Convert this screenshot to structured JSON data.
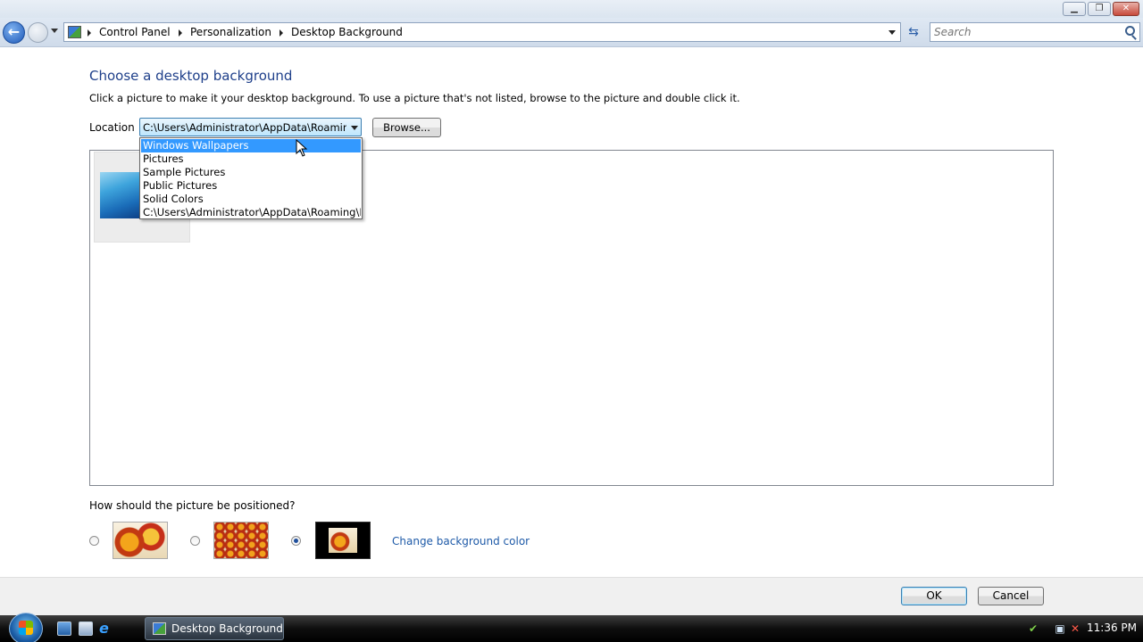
{
  "window": {
    "minimize_symbol": "▁",
    "maximize_symbol": "❐",
    "close_symbol": "✕"
  },
  "nav": {
    "breadcrumbs": [
      "Control Panel",
      "Personalization",
      "Desktop Background"
    ],
    "search_placeholder": "Search",
    "refresh_symbol": "⇆"
  },
  "main": {
    "title": "Choose a desktop background",
    "instructions": "Click a picture to make it your desktop background. To use a picture that's not listed, browse to the picture and double click it.",
    "location_label": "Location",
    "location_value": "C:\\Users\\Administrator\\AppData\\Roaming",
    "browse_label": "Browse...",
    "dropdown_options": [
      "Windows Wallpapers",
      "Pictures",
      "Sample Pictures",
      "Public Pictures",
      "Solid Colors",
      "C:\\Users\\Administrator\\AppData\\Roaming\\Mi"
    ],
    "dropdown_highlighted": "Windows Wallpapers",
    "position_question": "How should the picture be positioned?",
    "position_options": [
      "fit-to-screen",
      "tile",
      "center"
    ],
    "position_selected": "center",
    "change_bg_color_link": "Change background color"
  },
  "buttons": {
    "ok": "OK",
    "cancel": "Cancel"
  },
  "taskbar": {
    "active_task": "Desktop Background",
    "clock": "11:36 PM",
    "ie_symbol": "e"
  },
  "colors": {
    "title_blue": "#1e3f8a",
    "link_blue": "#1e5aa8",
    "selection_blue": "#3399ff"
  }
}
